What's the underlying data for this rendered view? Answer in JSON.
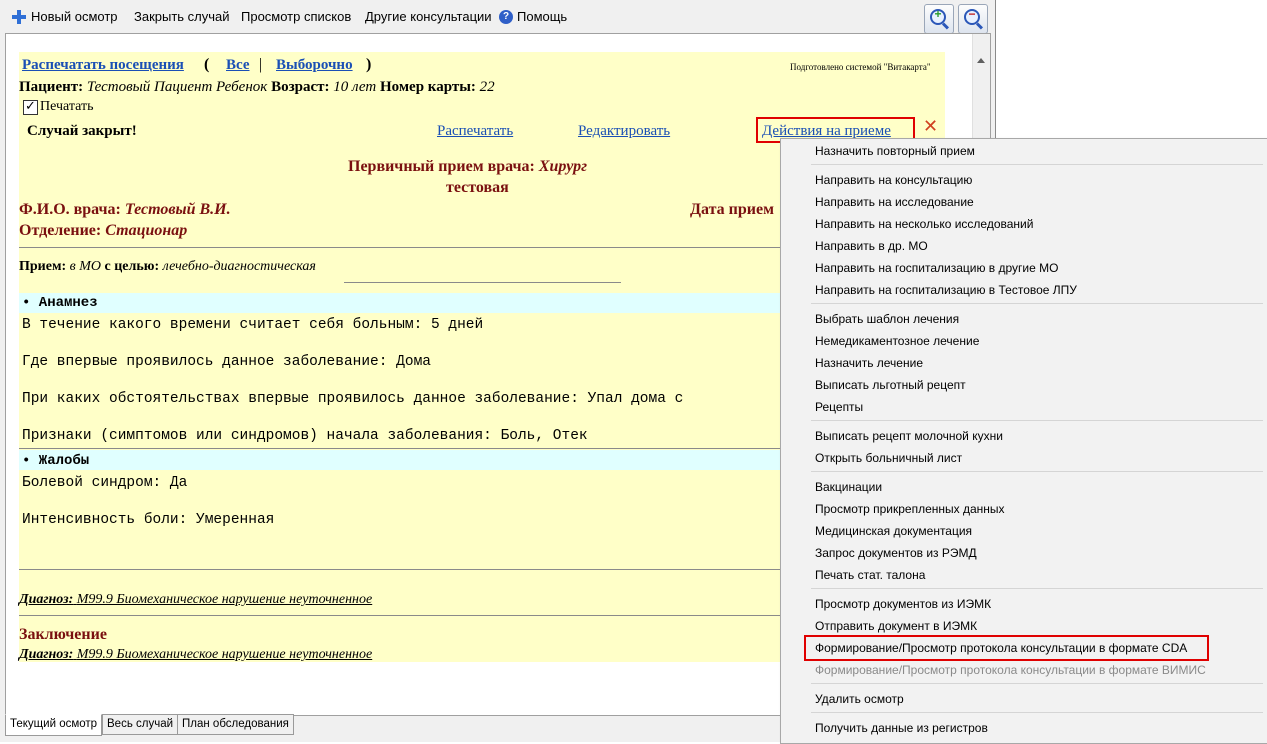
{
  "toolbar": {
    "new_exam": "Новый осмотр",
    "close_case": "Закрыть случай",
    "view_lists": "Просмотр списков",
    "other_consults": "Другие консультации",
    "help": "Помощь",
    "help_icon_glyph": "?"
  },
  "header": {
    "print_visits": "Распечатать посещения",
    "paren_open": "(",
    "all": "Все",
    "sep": "|",
    "selective": "Выборочно",
    "paren_close": ")",
    "prepared_by": "Подготовлено системой \"Витакарта\"",
    "patient_label": "Пациент:",
    "patient_value": "Тестовый Пациент Ребенок",
    "age_label": "Возраст:",
    "age_value": "10 лет",
    "card_label": "Номер карты:",
    "card_value": "22",
    "print_checkbox_label": "Печатать",
    "case_closed": "Случай закрыт!",
    "print_link": "Распечатать",
    "edit_link": "Редактировать",
    "actions_link": "Действия на приеме",
    "close_glyph": "✕"
  },
  "visit": {
    "title_label": "Первичный прием врача:",
    "title_value": "Хирург",
    "subtitle": "тестовая",
    "doctor_label": "Ф.И.О. врача:",
    "doctor_value": "Тестовый В.И.",
    "date_label": "Дата прием",
    "dept_label": "Отделение:",
    "dept_value": "Стационар",
    "reception_label": "Прием:",
    "reception_place": "в МО",
    "purpose_label": "с целью:",
    "purpose_value": "лечебно-диагностическая"
  },
  "anamnesis": {
    "title": "• Анамнез",
    "lines": [
      "В течение какого времени считает себя больным: 5 дней",
      "Где впервые проявилось данное заболевание: Дома",
      "При каких обстоятельствах впервые проявилось данное заболевание: Упал дома с",
      "Признаки (симптомов или синдромов) начала заболевания: Боль, Отек"
    ]
  },
  "complaints": {
    "title": "• Жалобы",
    "lines": [
      "Болевой синдром: Да",
      "Интенсивность боли: Умеренная"
    ]
  },
  "diagnosis": {
    "label": "Диагноз:",
    "value": "M99.9 Биомеханическое нарушение неуточненное"
  },
  "conclusion": {
    "title": "Заключение",
    "diag_label": "Диагноз:",
    "diag_value": "M99.9 Биомеханическое нарушение неуточненное"
  },
  "tabs": [
    "Текущий осмотр",
    "Весь случай",
    "План обследования"
  ],
  "menu": {
    "items": [
      "Назначить повторный прием",
      "Направить на консультацию",
      "Направить на исследование",
      "Направить на несколько исследований",
      "Направить в др. МО",
      "Направить на госпитализацию в другие МО",
      "Направить на госпитализацию в Тестовое ЛПУ",
      "Выбрать шаблон лечения",
      "Немедикаментозное лечение",
      "Назначить лечение",
      "Выписать льготный рецепт",
      "Рецепты",
      "Выписать рецепт молочной кухни",
      "Открыть больничный лист",
      "Вакцинации",
      "Просмотр прикрепленных данных",
      "Медицинская документация",
      "Запрос документов из РЭМД",
      "Печать стат. талона",
      "Просмотр документов из ИЭМК",
      "Отправить документ в ИЭМК",
      "Формирование/Просмотр протокола консультации в формате CDA",
      "Формирование/Просмотр протокола консультации в формате ВИМИС",
      "Удалить осмотр",
      "Получить данные из регистров"
    ]
  },
  "colors": {
    "content_bg": "#ffffc8",
    "section_bg": "#e0ffff",
    "link": "#1a4fb5",
    "heading": "#7a1010",
    "highlight": "#e00000"
  }
}
